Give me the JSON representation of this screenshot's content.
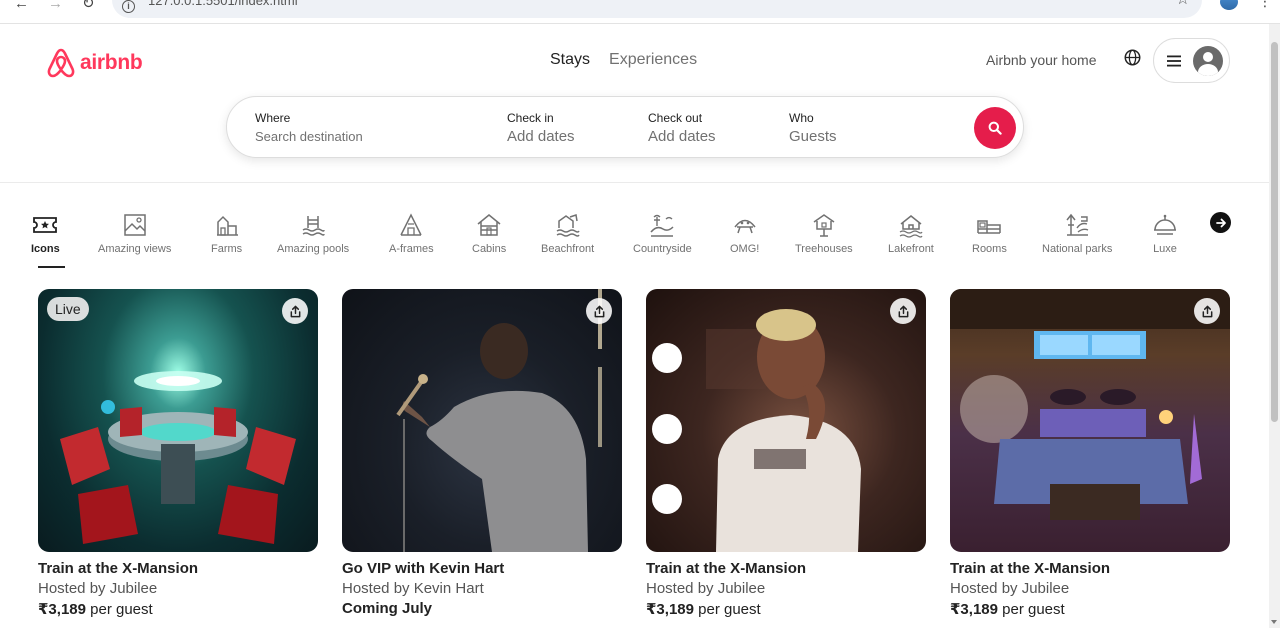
{
  "browser": {
    "url": "127.0.0.1:5501/index.html"
  },
  "header": {
    "brand": "airbnb",
    "tabs": [
      {
        "label": "Stays",
        "active": true
      },
      {
        "label": "Experiences",
        "active": false
      }
    ],
    "host_link": "Airbnb your home",
    "icons": {
      "globe": "globe-icon",
      "menu": "hamburger-menu-icon",
      "avatar": "user-avatar-icon"
    }
  },
  "search": {
    "where_label": "Where",
    "where_placeholder": "Search destination",
    "checkin_label": "Check in",
    "checkin_value": "Add dates",
    "checkout_label": "Check out",
    "checkout_value": "Add dates",
    "who_label": "Who",
    "who_value": "Guests"
  },
  "categories": [
    {
      "label": "Icons",
      "icon": "icons-ticket-icon",
      "active": true
    },
    {
      "label": "Amazing views",
      "icon": "amazing-views-icon"
    },
    {
      "label": "Farms",
      "icon": "farms-icon"
    },
    {
      "label": "Amazing pools",
      "icon": "pools-icon"
    },
    {
      "label": "A-frames",
      "icon": "a-frame-icon"
    },
    {
      "label": "Cabins",
      "icon": "cabins-icon"
    },
    {
      "label": "Beachfront",
      "icon": "beachfront-icon"
    },
    {
      "label": "Countryside",
      "icon": "countryside-icon"
    },
    {
      "label": "OMG!",
      "icon": "omg-icon"
    },
    {
      "label": "Treehouses",
      "icon": "treehouse-icon"
    },
    {
      "label": "Lakefront",
      "icon": "lakefront-icon"
    },
    {
      "label": "Rooms",
      "icon": "rooms-icon"
    },
    {
      "label": "National parks",
      "icon": "national-parks-icon"
    },
    {
      "label": "Luxe",
      "icon": "luxe-icon"
    }
  ],
  "listings": [
    {
      "badge": "Live",
      "title": "Train at the X-Mansion",
      "host": "Hosted by Jubilee",
      "price": "₹3,189",
      "price_suffix": " per guest"
    },
    {
      "badge": "",
      "title": "Go VIP with Kevin Hart",
      "host": "Hosted by Kevin Hart",
      "price": "Coming July",
      "price_suffix": ""
    },
    {
      "badge": "",
      "title": "Train at the X-Mansion",
      "host": "Hosted by Jubilee",
      "price": "₹3,189",
      "price_suffix": " per guest"
    },
    {
      "badge": "",
      "title": "Train at the X-Mansion",
      "host": "Hosted by Jubilee",
      "price": "₹3,189",
      "price_suffix": " per guest"
    }
  ],
  "colors": {
    "brand": "#ff385c",
    "search_button": "#e51d4b",
    "text": "#222222",
    "muted": "#717171"
  }
}
